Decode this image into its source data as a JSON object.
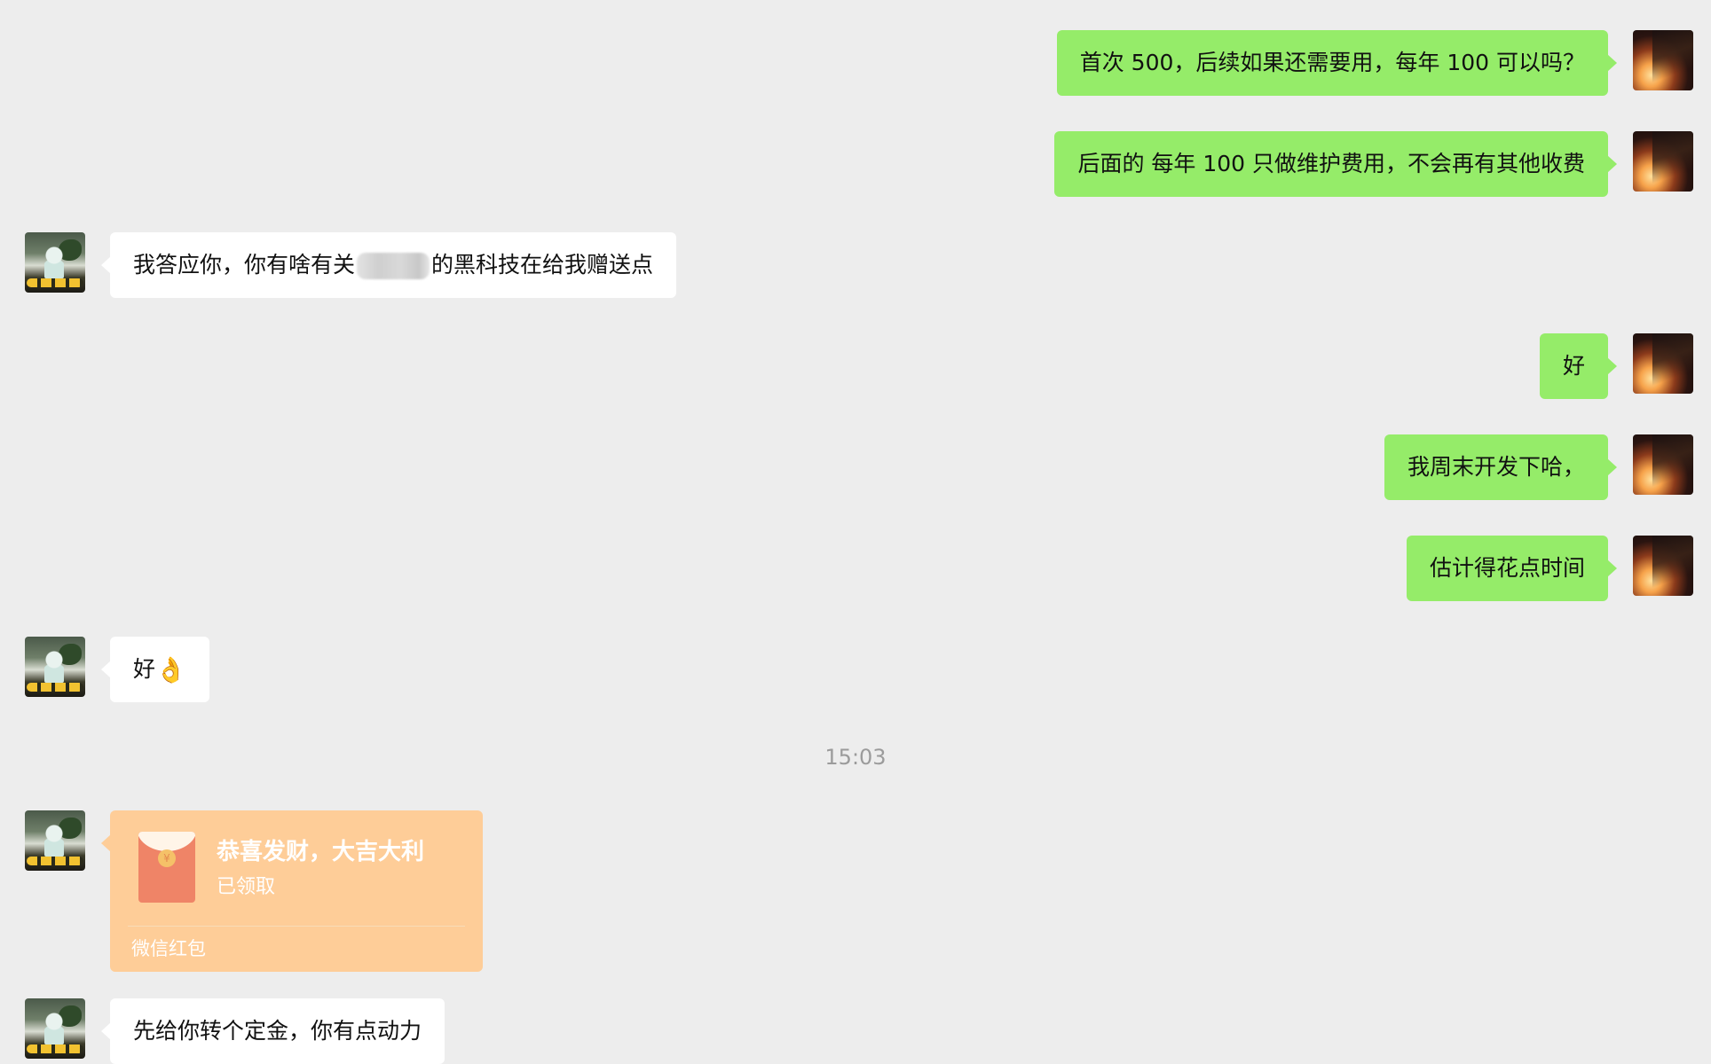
{
  "messages": [
    {
      "side": "me",
      "text": "首次 500，后续如果还需要用，每年 100 可以吗？"
    },
    {
      "side": "me",
      "text": "后面的 每年 100 只做维护费用，不会再有其他收费"
    },
    {
      "side": "them",
      "text_before": "我答应你，你有啥有关",
      "text_after": "的黑科技在给我赠送点"
    },
    {
      "side": "me",
      "text": "好"
    },
    {
      "side": "me",
      "text": "我周末开发下哈，"
    },
    {
      "side": "me",
      "text": "估计得花点时间"
    },
    {
      "side": "them",
      "text": "好",
      "emoji": "👌"
    },
    {
      "side": "them",
      "type": "red_packet",
      "title": "恭喜发财，大吉大利",
      "status": "已领取",
      "footer": "微信红包",
      "seal": "¥"
    },
    {
      "side": "them",
      "text": "先给你转个定金，你有点动力"
    }
  ],
  "timestamp": "15:03",
  "colors": {
    "background": "#ededed",
    "my_bubble": "#95ec69",
    "their_bubble": "#ffffff",
    "red_packet": "#fecd98",
    "timestamp_text": "#9b9b9b"
  },
  "icons": {
    "my_avatar": "avatar-icon",
    "their_avatar": "avatar-icon",
    "red_packet": "red-envelope-icon",
    "emoji": "ok-hand-emoji"
  }
}
